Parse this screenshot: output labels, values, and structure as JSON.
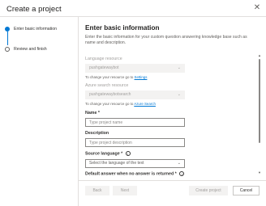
{
  "dialog": {
    "title": "Create a project",
    "close_glyph": "✕"
  },
  "stepper": {
    "steps": [
      {
        "label": "Enter basic information",
        "state": "active"
      },
      {
        "label": "Review and finish",
        "state": "inactive"
      }
    ]
  },
  "section": {
    "title": "Enter basic information",
    "description": "Enter the basic information for your custom question answering knowledge base such as name and description."
  },
  "form": {
    "language_resource": {
      "label": "Language resource",
      "value": "pushgatewaybot",
      "hint_prefix": "To change your resource go to",
      "hint_link": "Settings"
    },
    "search_resource": {
      "label": "Azure search resource",
      "value": "pushgatewaybotsearch",
      "hint_prefix": "To change your resource go to",
      "hint_link": "Azure Search"
    },
    "name": {
      "label": "Name *",
      "placeholder": "Type project name",
      "value": ""
    },
    "description": {
      "label": "Description",
      "placeholder": "Type project description",
      "value": ""
    },
    "source_language": {
      "label": "Source language *",
      "placeholder": "Select the language of the text",
      "info_glyph": "i"
    },
    "default_answer": {
      "label": "Default answer when no answer is returned *",
      "info_glyph": "i"
    }
  },
  "footer": {
    "back_label": "Back",
    "next_label": "Next",
    "create_label": "Create project",
    "cancel_label": "Cancel"
  },
  "icons": {
    "chevron": "⌄",
    "scroll_up": "▲",
    "scroll_down": "▼"
  },
  "colors": {
    "accent": "#0078d4",
    "disabled_bg": "#f3f2f1",
    "disabled_text": "#a19f9d"
  }
}
